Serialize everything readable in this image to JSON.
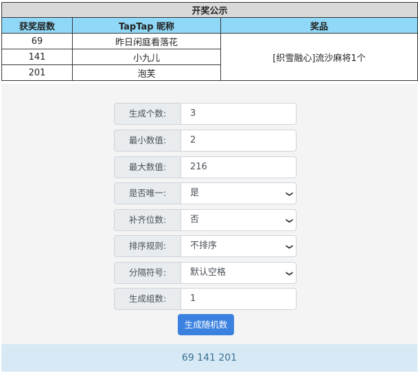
{
  "table": {
    "title": "开奖公示",
    "headers": [
      "获奖层数",
      "TapTap 昵称",
      "奖品"
    ],
    "rows": [
      {
        "floor": "69",
        "nickname": "昨日闲庭看落花"
      },
      {
        "floor": "141",
        "nickname": "小九儿"
      },
      {
        "floor": "201",
        "nickname": "泡芙"
      }
    ],
    "prize": "[织雪融心]流沙麻将1个"
  },
  "form": {
    "count_label": "生成个数:",
    "count_value": "3",
    "min_label": "最小数值:",
    "min_value": "2",
    "max_label": "最大数值:",
    "max_value": "216",
    "unique_label": "是否唯一:",
    "unique_value": "是",
    "pad_label": "补齐位数:",
    "pad_value": "否",
    "sort_label": "排序规则:",
    "sort_value": "不排序",
    "sep_label": "分隔符号:",
    "sep_value": "默认空格",
    "groups_label": "生成组数:",
    "groups_value": "1",
    "submit_label": "生成随机数"
  },
  "result": {
    "text": "69 141 201"
  }
}
